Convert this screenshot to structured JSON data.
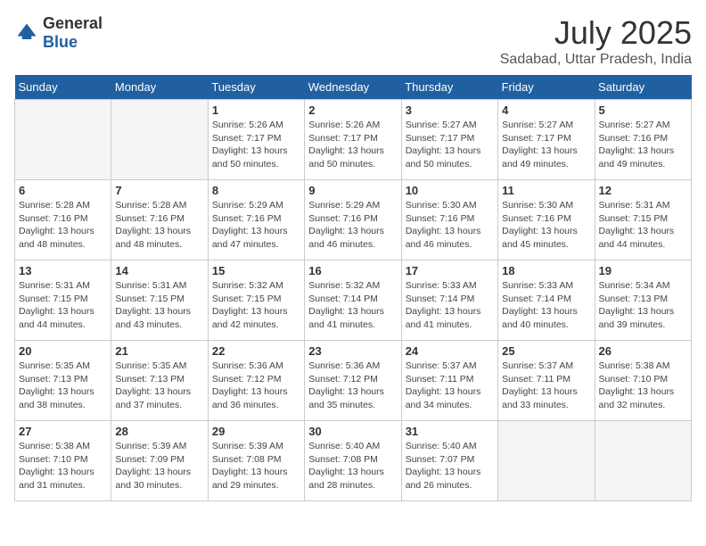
{
  "logo": {
    "text_general": "General",
    "text_blue": "Blue"
  },
  "title": "July 2025",
  "location": "Sadabad, Uttar Pradesh, India",
  "days_of_week": [
    "Sunday",
    "Monday",
    "Tuesday",
    "Wednesday",
    "Thursday",
    "Friday",
    "Saturday"
  ],
  "weeks": [
    [
      {
        "day": "",
        "info": ""
      },
      {
        "day": "",
        "info": ""
      },
      {
        "day": "1",
        "info": "Sunrise: 5:26 AM\nSunset: 7:17 PM\nDaylight: 13 hours\nand 50 minutes."
      },
      {
        "day": "2",
        "info": "Sunrise: 5:26 AM\nSunset: 7:17 PM\nDaylight: 13 hours\nand 50 minutes."
      },
      {
        "day": "3",
        "info": "Sunrise: 5:27 AM\nSunset: 7:17 PM\nDaylight: 13 hours\nand 50 minutes."
      },
      {
        "day": "4",
        "info": "Sunrise: 5:27 AM\nSunset: 7:17 PM\nDaylight: 13 hours\nand 49 minutes."
      },
      {
        "day": "5",
        "info": "Sunrise: 5:27 AM\nSunset: 7:16 PM\nDaylight: 13 hours\nand 49 minutes."
      }
    ],
    [
      {
        "day": "6",
        "info": "Sunrise: 5:28 AM\nSunset: 7:16 PM\nDaylight: 13 hours\nand 48 minutes."
      },
      {
        "day": "7",
        "info": "Sunrise: 5:28 AM\nSunset: 7:16 PM\nDaylight: 13 hours\nand 48 minutes."
      },
      {
        "day": "8",
        "info": "Sunrise: 5:29 AM\nSunset: 7:16 PM\nDaylight: 13 hours\nand 47 minutes."
      },
      {
        "day": "9",
        "info": "Sunrise: 5:29 AM\nSunset: 7:16 PM\nDaylight: 13 hours\nand 46 minutes."
      },
      {
        "day": "10",
        "info": "Sunrise: 5:30 AM\nSunset: 7:16 PM\nDaylight: 13 hours\nand 46 minutes."
      },
      {
        "day": "11",
        "info": "Sunrise: 5:30 AM\nSunset: 7:16 PM\nDaylight: 13 hours\nand 45 minutes."
      },
      {
        "day": "12",
        "info": "Sunrise: 5:31 AM\nSunset: 7:15 PM\nDaylight: 13 hours\nand 44 minutes."
      }
    ],
    [
      {
        "day": "13",
        "info": "Sunrise: 5:31 AM\nSunset: 7:15 PM\nDaylight: 13 hours\nand 44 minutes."
      },
      {
        "day": "14",
        "info": "Sunrise: 5:31 AM\nSunset: 7:15 PM\nDaylight: 13 hours\nand 43 minutes."
      },
      {
        "day": "15",
        "info": "Sunrise: 5:32 AM\nSunset: 7:15 PM\nDaylight: 13 hours\nand 42 minutes."
      },
      {
        "day": "16",
        "info": "Sunrise: 5:32 AM\nSunset: 7:14 PM\nDaylight: 13 hours\nand 41 minutes."
      },
      {
        "day": "17",
        "info": "Sunrise: 5:33 AM\nSunset: 7:14 PM\nDaylight: 13 hours\nand 41 minutes."
      },
      {
        "day": "18",
        "info": "Sunrise: 5:33 AM\nSunset: 7:14 PM\nDaylight: 13 hours\nand 40 minutes."
      },
      {
        "day": "19",
        "info": "Sunrise: 5:34 AM\nSunset: 7:13 PM\nDaylight: 13 hours\nand 39 minutes."
      }
    ],
    [
      {
        "day": "20",
        "info": "Sunrise: 5:35 AM\nSunset: 7:13 PM\nDaylight: 13 hours\nand 38 minutes."
      },
      {
        "day": "21",
        "info": "Sunrise: 5:35 AM\nSunset: 7:13 PM\nDaylight: 13 hours\nand 37 minutes."
      },
      {
        "day": "22",
        "info": "Sunrise: 5:36 AM\nSunset: 7:12 PM\nDaylight: 13 hours\nand 36 minutes."
      },
      {
        "day": "23",
        "info": "Sunrise: 5:36 AM\nSunset: 7:12 PM\nDaylight: 13 hours\nand 35 minutes."
      },
      {
        "day": "24",
        "info": "Sunrise: 5:37 AM\nSunset: 7:11 PM\nDaylight: 13 hours\nand 34 minutes."
      },
      {
        "day": "25",
        "info": "Sunrise: 5:37 AM\nSunset: 7:11 PM\nDaylight: 13 hours\nand 33 minutes."
      },
      {
        "day": "26",
        "info": "Sunrise: 5:38 AM\nSunset: 7:10 PM\nDaylight: 13 hours\nand 32 minutes."
      }
    ],
    [
      {
        "day": "27",
        "info": "Sunrise: 5:38 AM\nSunset: 7:10 PM\nDaylight: 13 hours\nand 31 minutes."
      },
      {
        "day": "28",
        "info": "Sunrise: 5:39 AM\nSunset: 7:09 PM\nDaylight: 13 hours\nand 30 minutes."
      },
      {
        "day": "29",
        "info": "Sunrise: 5:39 AM\nSunset: 7:08 PM\nDaylight: 13 hours\nand 29 minutes."
      },
      {
        "day": "30",
        "info": "Sunrise: 5:40 AM\nSunset: 7:08 PM\nDaylight: 13 hours\nand 28 minutes."
      },
      {
        "day": "31",
        "info": "Sunrise: 5:40 AM\nSunset: 7:07 PM\nDaylight: 13 hours\nand 26 minutes."
      },
      {
        "day": "",
        "info": ""
      },
      {
        "day": "",
        "info": ""
      }
    ]
  ]
}
